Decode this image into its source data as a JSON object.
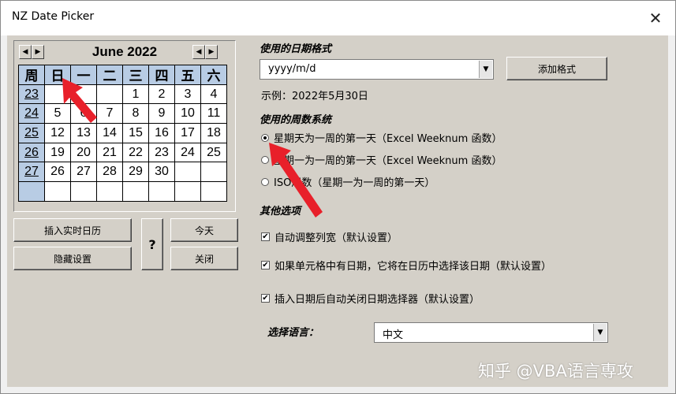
{
  "window": {
    "title": "NZ Date Picker",
    "close_glyph": "✕"
  },
  "calendar": {
    "month_label": "June 2022",
    "prev_glyph": "◀",
    "next_glyph": "▶",
    "headers": [
      "周",
      "日",
      "一",
      "二",
      "三",
      "四",
      "五",
      "六"
    ],
    "rows": [
      [
        "23",
        "",
        "",
        "",
        "1",
        "2",
        "3",
        "4"
      ],
      [
        "24",
        "5",
        "6",
        "7",
        "8",
        "9",
        "10",
        "11"
      ],
      [
        "25",
        "12",
        "13",
        "14",
        "15",
        "16",
        "17",
        "18"
      ],
      [
        "26",
        "19",
        "20",
        "21",
        "22",
        "23",
        "24",
        "25"
      ],
      [
        "27",
        "26",
        "27",
        "28",
        "29",
        "30",
        "",
        ""
      ],
      [
        "",
        "",
        "",
        "",
        "",
        "",
        "",
        ""
      ]
    ]
  },
  "buttons": {
    "insert_live_calendar": "插入实时日历",
    "hide_settings": "隐藏设置",
    "help": "?",
    "today": "今天",
    "close": "关闭",
    "add_format": "添加格式"
  },
  "date_format": {
    "label": "使用的日期格式",
    "value": "yyyy/m/d",
    "example": "示例：2022年5月30日"
  },
  "week_system": {
    "label": "使用的周数系统",
    "options": [
      {
        "label": "星期天为一周的第一天（Excel Weeknum 函数）",
        "selected": true
      },
      {
        "label": "星期一为一周的第一天（Excel Weeknum 函数）",
        "selected": false
      },
      {
        "label": "ISO周数（星期一为一周的第一天）",
        "selected": false
      }
    ]
  },
  "other_options": {
    "label": "其他选项",
    "items": [
      {
        "label": "自动调整列宽（默认设置）",
        "checked": true
      },
      {
        "label": "如果单元格中有日期，它将在日历中选择该日期（默认设置）",
        "checked": true
      },
      {
        "label": "插入日期后自动关闭日期选择器（默认设置）",
        "checked": true
      }
    ],
    "check_glyph": "✔"
  },
  "language": {
    "label": "选择语言：",
    "value": "中文"
  },
  "watermark": "知乎 @VBA语言専攻",
  "colors": {
    "header_bg": "#b8cce4",
    "dialog_bg": "#d4d0c8",
    "annotation_arrow": "#e8202a"
  }
}
